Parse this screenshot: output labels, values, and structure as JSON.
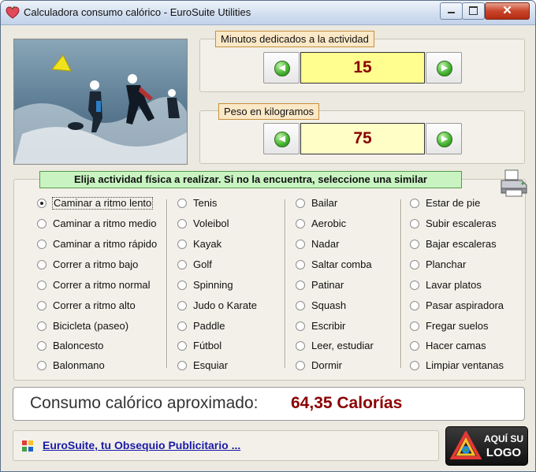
{
  "window": {
    "title": "Calculadora consumo calórico - EuroSuite Utilities",
    "close_glyph": "✕"
  },
  "minutes": {
    "label": "Minutos dedicados a la actividad",
    "value": "15",
    "value_bg": "#fffe8e"
  },
  "weight": {
    "label": "Peso en kilogramos",
    "value": "75",
    "value_bg": "#fffec7"
  },
  "activity": {
    "header": "Elija actividad física a realizar. Si no la encuentra, seleccione una similar",
    "columns": [
      [
        "Caminar a ritmo lento",
        "Caminar a ritmo medio",
        "Caminar a ritmo rápido",
        "Correr a ritmo bajo",
        "Correr a ritmo normal",
        "Correr a ritmo alto",
        "Bicicleta (paseo)",
        "Baloncesto",
        "Balonmano"
      ],
      [
        "Tenis",
        "Voleibol",
        "Kayak",
        "Golf",
        "Spinning",
        "Judo o Karate",
        "Paddle",
        "Fútbol",
        "Esquiar"
      ],
      [
        "Bailar",
        "Aerobic",
        "Nadar",
        "Saltar comba",
        "Patinar",
        "Squash",
        "Escribir",
        "Leer, estudiar",
        "Dormir"
      ],
      [
        "Estar de pie",
        "Subir escaleras",
        "Bajar escaleras",
        "Planchar",
        "Lavar platos",
        "Pasar aspiradora",
        "Fregar suelos",
        "Hacer camas",
        "Limpiar ventanas"
      ]
    ],
    "selected": "Caminar a ritmo lento"
  },
  "result": {
    "label": "Consumo calórico aproximado:",
    "value": "64,35 Calorías"
  },
  "footer": {
    "link": "EuroSuite, tu Obsequio Publicitario ..."
  },
  "logo": {
    "line1": "AQUÍ SU",
    "line2": "LOGO"
  },
  "icons": {
    "app": "apple-heart-icon",
    "print": "printer-icon",
    "decrease": "arrow-left-icon",
    "increase": "arrow-right-icon",
    "footer": "eurosuite-icon"
  }
}
